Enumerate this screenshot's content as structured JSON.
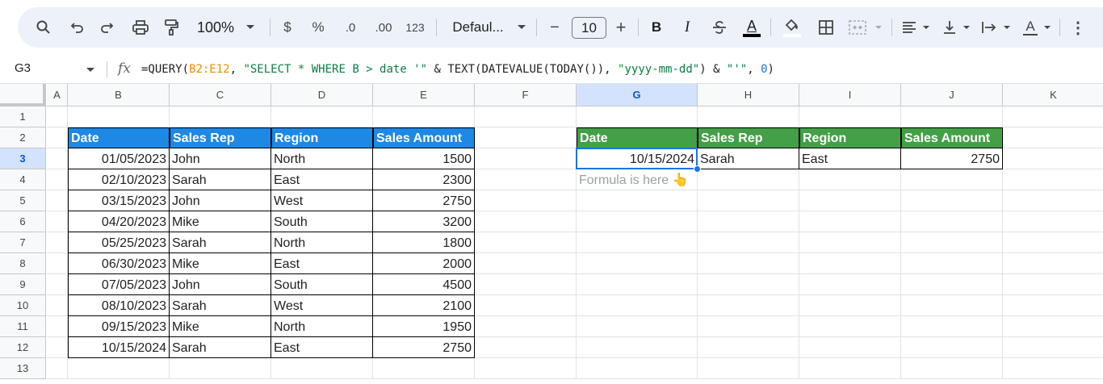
{
  "toolbar": {
    "zoom": "100%",
    "currency": "$",
    "percent": "%",
    "dec_decrease": ".0",
    "dec_increase": ".00",
    "format_123": "123",
    "font": "Defaul...",
    "font_size": "10",
    "minus": "−",
    "plus": "+",
    "bold": "B",
    "italic": "I",
    "text_color_letter": "A",
    "text_rotate_letter": "A",
    "more": "⋮"
  },
  "formula_bar": {
    "cell_ref": "G3",
    "fx": "fx",
    "parts": [
      {
        "t": "=QUERY(",
        "c": ""
      },
      {
        "t": "B2:E12",
        "c": "f-range"
      },
      {
        "t": ", ",
        "c": ""
      },
      {
        "t": "\"SELECT * WHERE B > date '\"",
        "c": "f-str"
      },
      {
        "t": " & TEXT(DATEVALUE(TODAY()), ",
        "c": ""
      },
      {
        "t": "\"yyyy-mm-dd\"",
        "c": "f-str"
      },
      {
        "t": ") & ",
        "c": ""
      },
      {
        "t": "\"'\"",
        "c": "f-str"
      },
      {
        "t": ", ",
        "c": ""
      },
      {
        "t": "0",
        "c": "f-num"
      },
      {
        "t": ")",
        "c": ""
      }
    ]
  },
  "columns": [
    "A",
    "B",
    "C",
    "D",
    "E",
    "F",
    "G",
    "H",
    "I",
    "J",
    "K"
  ],
  "selected_column": "G",
  "rows": [
    "1",
    "2",
    "3",
    "4",
    "5",
    "6",
    "7",
    "8",
    "9",
    "10",
    "11",
    "12",
    "13"
  ],
  "selected_row": "3",
  "source_table": {
    "headers": [
      "Date",
      "Sales Rep",
      "Region",
      "Sales Amount"
    ],
    "rows": [
      [
        "01/05/2023",
        "John",
        "North",
        "1500"
      ],
      [
        "02/10/2023",
        "Sarah",
        "East",
        "2300"
      ],
      [
        "03/15/2023",
        "John",
        "West",
        "2750"
      ],
      [
        "04/20/2023",
        "Mike",
        "South",
        "3200"
      ],
      [
        "05/25/2023",
        "Sarah",
        "North",
        "1800"
      ],
      [
        "06/30/2023",
        "Mike",
        "East",
        "2000"
      ],
      [
        "07/05/2023",
        "John",
        "South",
        "4500"
      ],
      [
        "08/10/2023",
        "Sarah",
        "West",
        "2100"
      ],
      [
        "09/15/2023",
        "Mike",
        "North",
        "1950"
      ],
      [
        "10/15/2024",
        "Sarah",
        "East",
        "2750"
      ]
    ]
  },
  "result_table": {
    "headers": [
      "Date",
      "Sales Rep",
      "Region",
      "Sales Amount"
    ],
    "rows": [
      [
        "10/15/2024",
        "Sarah",
        "East",
        "2750"
      ]
    ]
  },
  "note": "Formula is here 👆",
  "colors": {
    "source_header": "#1e88e5",
    "result_header": "#43a047",
    "selection": "#1a73e8",
    "toolbar_bg": "#edf2fa"
  },
  "icons": [
    "search-icon",
    "undo-icon",
    "redo-icon",
    "print-icon",
    "paint-format-icon",
    "chevron-down-icon",
    "strikethrough-icon",
    "fill-color-icon",
    "borders-icon",
    "merge-cells-icon",
    "align-horizontal-icon",
    "align-vertical-icon",
    "text-wrap-icon",
    "text-rotate-icon",
    "more-options-icon"
  ]
}
